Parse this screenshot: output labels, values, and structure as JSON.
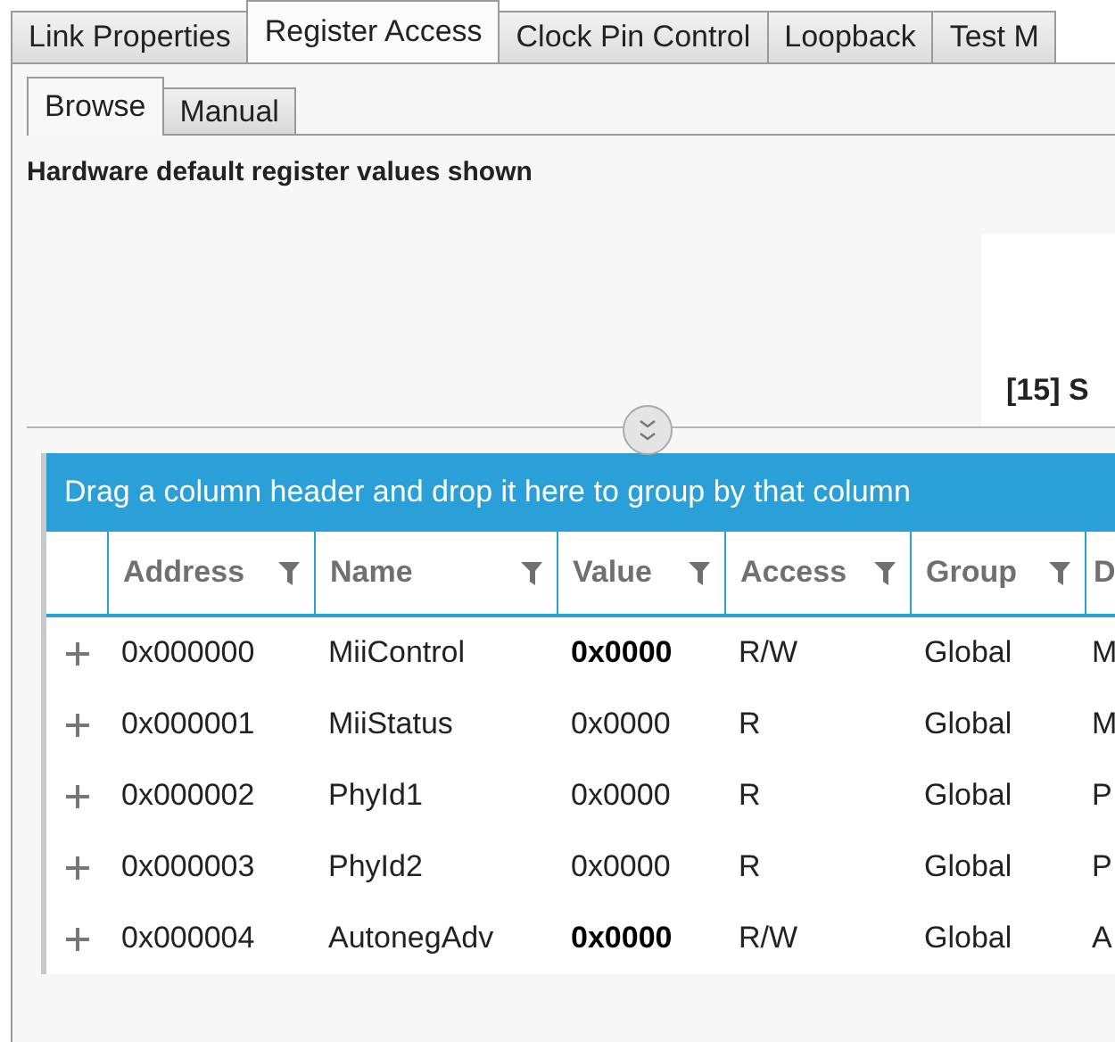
{
  "tabs": [
    {
      "label": "Link Properties",
      "selected": false
    },
    {
      "label": "Register Access",
      "selected": true
    },
    {
      "label": "Clock Pin Control",
      "selected": false
    },
    {
      "label": "Loopback",
      "selected": false
    },
    {
      "label": "Test M",
      "selected": false
    }
  ],
  "sub_tabs": [
    {
      "label": "Browse",
      "selected": true
    },
    {
      "label": "Manual",
      "selected": false
    }
  ],
  "info_text": "Hardware default register values shown",
  "detail_panel": {
    "heading": "[15] S"
  },
  "grid": {
    "group_hint": "Drag a column header and drop it here to group by that column",
    "columns": [
      {
        "label": "Address",
        "filter": true
      },
      {
        "label": "Name",
        "filter": true
      },
      {
        "label": "Value",
        "filter": true
      },
      {
        "label": "Access",
        "filter": true
      },
      {
        "label": "Group",
        "filter": true
      },
      {
        "label": "D",
        "filter": false
      }
    ],
    "rows": [
      {
        "address": "0x000000",
        "name": "MiiControl",
        "value": "0x0000",
        "value_modified": true,
        "access": "R/W",
        "group": "Global",
        "column_6": "M"
      },
      {
        "address": "0x000001",
        "name": "MiiStatus",
        "value": "0x0000",
        "value_modified": false,
        "access": "R",
        "group": "Global",
        "column_6": "M"
      },
      {
        "address": "0x000002",
        "name": "PhyId1",
        "value": "0x0000",
        "value_modified": false,
        "access": "R",
        "group": "Global",
        "column_6": "P"
      },
      {
        "address": "0x000003",
        "name": "PhyId2",
        "value": "0x0000",
        "value_modified": false,
        "access": "R",
        "group": "Global",
        "column_6": "P"
      },
      {
        "address": "0x000004",
        "name": "AutonegAdv",
        "value": "0x0000",
        "value_modified": true,
        "access": "R/W",
        "group": "Global",
        "column_6": "A"
      }
    ]
  }
}
